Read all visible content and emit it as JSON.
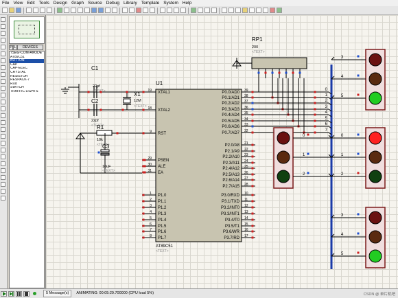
{
  "menu": [
    "File",
    "View",
    "Edit",
    "Tools",
    "Design",
    "Graph",
    "Source",
    "Debug",
    "Library",
    "Template",
    "System",
    "Help"
  ],
  "panel": {
    "p_label": "P",
    "l_label": "L",
    "title": "DEVICES",
    "devices": [
      "7SEG-COM-ANODE",
      "AT89C51",
      "BUTTON",
      "CAP",
      "CAP-ELEC",
      "CRYSTAL",
      "RESISTOR",
      "RESPACK-7",
      "RX8",
      "SWITCH",
      "TRAFFIC LIGHTS"
    ],
    "selected_index": 2
  },
  "schematic": {
    "rp1": {
      "ref": "RP1",
      "value": "200",
      "text": "<TEXT>"
    },
    "c1": {
      "ref": "C1",
      "value": "22pf",
      "text": "<TEXT>"
    },
    "c2": {
      "ref": "C2",
      "value": "22pf",
      "text": "<TEXT>"
    },
    "x1": {
      "ref": "X1",
      "value": "12M",
      "text": "<TEXT>"
    },
    "r1": {
      "ref": "R1",
      "value": "10k",
      "text": "<TEXT>"
    },
    "c3": {
      "ref": "C3",
      "value": "10uF",
      "text": "<TEXT>"
    },
    "u1": {
      "ref": "U1",
      "part": "AT89C51",
      "text": "<TEXT>"
    },
    "left_pins": [
      {
        "num": "19",
        "name": "XTAL1"
      },
      {
        "num": "18",
        "name": "XTAL2"
      },
      {
        "num": "9",
        "name": "RST"
      },
      {
        "num": "29",
        "name": "PSEN"
      },
      {
        "num": "30",
        "name": "ALE"
      },
      {
        "num": "31",
        "name": "EA"
      },
      {
        "num": "1",
        "name": "P1.0"
      },
      {
        "num": "2",
        "name": "P1.1"
      },
      {
        "num": "3",
        "name": "P1.2"
      },
      {
        "num": "4",
        "name": "P1.3"
      },
      {
        "num": "5",
        "name": "P1.4"
      },
      {
        "num": "6",
        "name": "P1.5"
      },
      {
        "num": "7",
        "name": "P1.6"
      },
      {
        "num": "8",
        "name": "P1.7"
      }
    ],
    "p0_pins": [
      {
        "num": "39",
        "name": "P0.0/AD0"
      },
      {
        "num": "38",
        "name": "P0.1/AD1"
      },
      {
        "num": "37",
        "name": "P0.2/AD2"
      },
      {
        "num": "36",
        "name": "P0.3/AD3"
      },
      {
        "num": "35",
        "name": "P0.4/AD4"
      },
      {
        "num": "34",
        "name": "P0.5/AD5"
      },
      {
        "num": "33",
        "name": "P0.6/AD6"
      },
      {
        "num": "32",
        "name": "P0.7/AD7"
      }
    ],
    "p2_pins": [
      {
        "num": "21",
        "name": "P2.0/A8"
      },
      {
        "num": "22",
        "name": "P2.1/A9"
      },
      {
        "num": "23",
        "name": "P2.2/A10"
      },
      {
        "num": "24",
        "name": "P2.3/A11"
      },
      {
        "num": "25",
        "name": "P2.4/A12"
      },
      {
        "num": "26",
        "name": "P2.5/A13"
      },
      {
        "num": "27",
        "name": "P2.6/A14"
      },
      {
        "num": "28",
        "name": "P2.7/A15"
      }
    ],
    "p3_pins": [
      {
        "num": "10",
        "name": "P3.0/RXD"
      },
      {
        "num": "11",
        "name": "P3.1/TXD"
      },
      {
        "num": "12",
        "name": "P3.2/INT0"
      },
      {
        "num": "13",
        "name": "P3.3/INT1"
      },
      {
        "num": "14",
        "name": "P3.4/T0"
      },
      {
        "num": "15",
        "name": "P3.5/T1"
      },
      {
        "num": "16",
        "name": "P3.6/WR"
      },
      {
        "num": "17",
        "name": "P3.7/RD"
      }
    ],
    "bus_labels": [
      "0",
      "1",
      "2",
      "3",
      "4",
      "5",
      "6",
      "7"
    ],
    "lights": [
      {
        "labels": [
          "3",
          "4",
          "5"
        ],
        "lit": 2
      },
      {
        "labels": [
          "0",
          "1",
          "2"
        ],
        "lit": -1
      },
      {
        "labels": [
          "0",
          "1",
          "2"
        ],
        "lit": 0
      },
      {
        "labels": [
          "3",
          "4",
          "5"
        ],
        "lit": 2
      }
    ],
    "colors": {
      "wire": "#000000",
      "pin_red": "#d02020",
      "pin_blue": "#2050d0",
      "bus": "#1a3aa8",
      "ic_fill": "#c8c4b0",
      "light_housing": "#f0dede",
      "light_border": "#7a1a1a",
      "red_on": "#ff2020",
      "red_off": "#6a1010",
      "amber_off": "#5a2a10",
      "green_on": "#22cc22",
      "green_off": "#104010",
      "text_blue": "#16329a",
      "text_gray": "#8a8a8a"
    }
  },
  "status": {
    "messages": "5 Message(s)",
    "animation": "ANIMATING: 00:05:29.700000 (CPU load 5%)",
    "watermark": "CSDN @ 单片机吧"
  }
}
